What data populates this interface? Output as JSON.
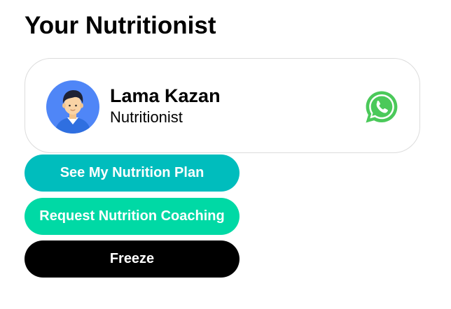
{
  "page": {
    "title": "Your Nutritionist"
  },
  "nutritionist": {
    "name": "Lama Kazan",
    "role": "Nutritionist",
    "avatar_icon": "avatar-icon",
    "contact_icon": "whatsapp-icon"
  },
  "actions": {
    "plan_label": "See My Nutrition Plan",
    "coaching_label": "Request Nutrition Coaching",
    "freeze_label": "Freeze"
  },
  "colors": {
    "plan_button": "#00BDBD",
    "coaching_button": "#00D9A5",
    "freeze_button": "#000000",
    "whatsapp": "#4BC95A",
    "avatar_bg": "#4F86F7"
  }
}
